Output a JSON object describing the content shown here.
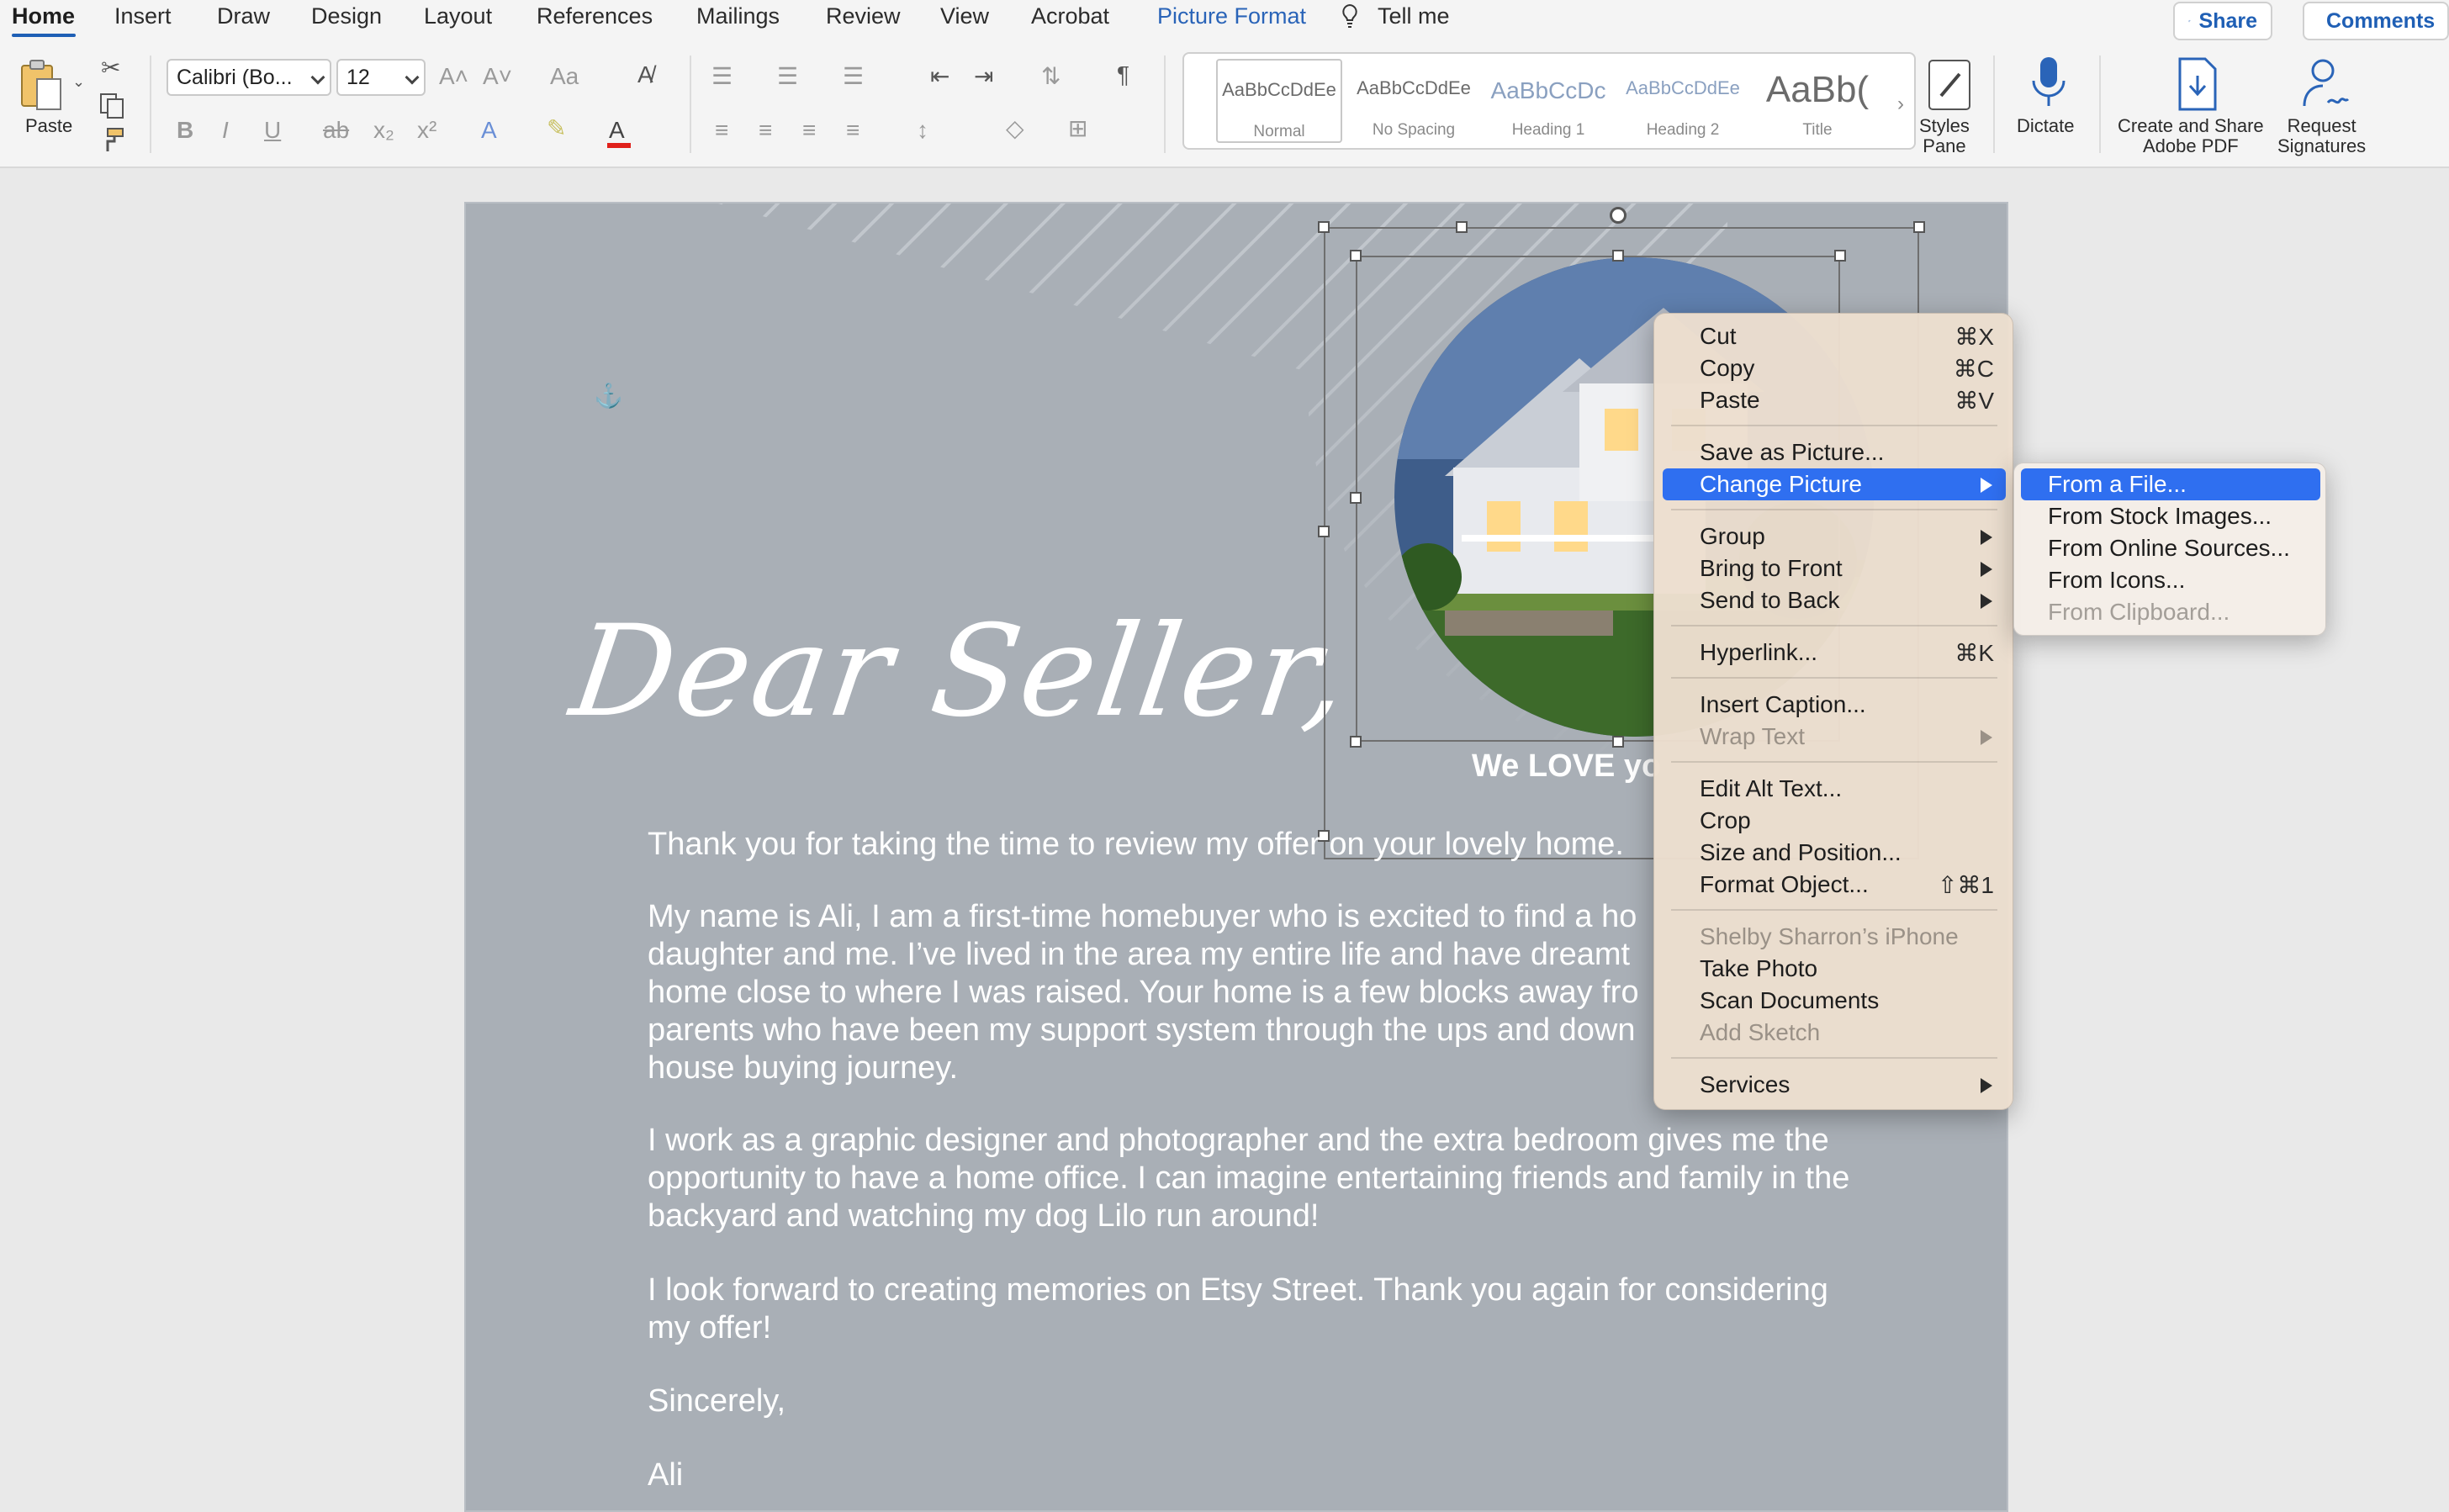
{
  "tabs": {
    "home": "Home",
    "insert": "Insert",
    "draw": "Draw",
    "design": "Design",
    "layout": "Layout",
    "references": "References",
    "mailings": "Mailings",
    "review": "Review",
    "view": "View",
    "acrobat": "Acrobat",
    "picture_format": "Picture Format",
    "tell_me": "Tell me"
  },
  "top_buttons": {
    "share": "Share",
    "comments": "Comments"
  },
  "ribbon": {
    "paste_label": "Paste",
    "font_name": "Calibri (Bo...",
    "font_size": "12",
    "styles": [
      {
        "sample": "AaBbCcDdEe",
        "name": "Normal"
      },
      {
        "sample": "AaBbCcDdEe",
        "name": "No Spacing"
      },
      {
        "sample": "AaBbCcDc",
        "name": "Heading 1"
      },
      {
        "sample": "AaBbCcDdEe",
        "name": "Heading 2"
      },
      {
        "sample": "AaBb(",
        "name": "Title"
      }
    ],
    "styles_pane": "Styles\nPane",
    "dictate": "Dictate",
    "create_share_pdf": "Create and Share\nAdobe PDF",
    "request_signatures": "Request\nSignatures"
  },
  "document": {
    "heading": "Dear Seller,",
    "caption": "We LOVE yo",
    "paragraphs": [
      "Thank you for taking the time to review my offer on your lovely home.",
      "My name is Ali, I am a first-time homebuyer who is excited to find a ho daughter and me. I’ve lived in the area my entire life and have dreamt home close to where I was raised. Your home is a few blocks away fro parents who have been my support system through the ups and down house buying journey.",
      "I work as a graphic designer and photographer and the extra bedroom gives me the opportunity to have a home office. I can imagine entertaining friends and family in the backyard and watching my dog Lilo run around!",
      "I look forward to creating memories on Etsy Street. Thank you again for considering my offer!",
      "Sincerely,",
      "Ali"
    ]
  },
  "context_menu": {
    "cut": "Cut",
    "cut_key": "⌘X",
    "copy": "Copy",
    "copy_key": "⌘C",
    "paste": "Paste",
    "paste_key": "⌘V",
    "save_as_picture": "Save as Picture...",
    "change_picture": "Change Picture",
    "group": "Group",
    "bring_to_front": "Bring to Front",
    "send_to_back": "Send to Back",
    "hyperlink": "Hyperlink...",
    "hyperlink_key": "⌘K",
    "insert_caption": "Insert Caption...",
    "wrap_text": "Wrap Text",
    "edit_alt_text": "Edit Alt Text...",
    "crop": "Crop",
    "size_and_position": "Size and Position...",
    "format_object": "Format Object...",
    "format_object_key": "⇧⌘1",
    "iphone": "Shelby Sharron’s iPhone",
    "take_photo": "Take Photo",
    "scan_documents": "Scan Documents",
    "add_sketch": "Add Sketch",
    "services": "Services"
  },
  "submenu": {
    "from_file": "From a File...",
    "from_stock": "From Stock Images...",
    "from_online": "From Online Sources...",
    "from_icons": "From Icons...",
    "from_clipboard": "From Clipboard..."
  },
  "colors": {
    "accent": "#2f6ff0",
    "page": "#a9afb6",
    "tab_active": "#1f5fb5"
  }
}
